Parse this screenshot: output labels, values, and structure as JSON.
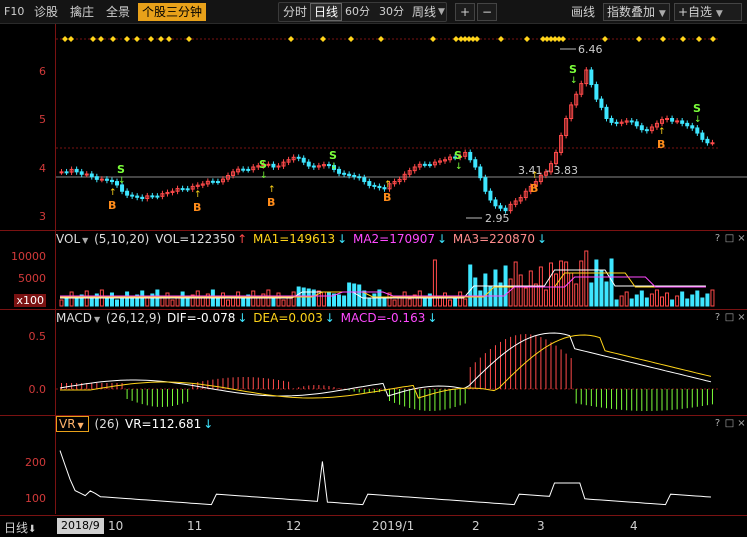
{
  "toolbar": {
    "f10": "F10",
    "diagnose": "诊股",
    "strategy": "擒庄",
    "panorama": "全景",
    "minute_label": "个股三分钟",
    "tf_intraday": "分时",
    "tf_daily": "日线",
    "tf_60": "60分",
    "tf_30": "30分",
    "tf_weekly": "周线",
    "zoom_in": "+",
    "zoom_out": "−",
    "draw": "画线",
    "index_overlay": "指数叠加",
    "add_watch": "+自选"
  },
  "price_panel": {
    "axis_labels": [
      "6",
      "5",
      "4",
      "3"
    ],
    "high_label": "6.46",
    "low_label": "2.95",
    "range_label": "3.41 - 3.83",
    "signal_b": "B",
    "signal_s": "S",
    "colors": {
      "up": "#ff4a4a",
      "down": "#3ee6ff",
      "signal_b": "#ff8c1a",
      "signal_s": "#7bff3a",
      "marker": "#ffd41a"
    }
  },
  "vol_panel": {
    "name": "VOL",
    "params": "(5,10,20)",
    "vol": "VOL=122350",
    "ma1": "MA1=149613",
    "ma2": "MA2=170907",
    "ma3": "MA3=220870",
    "axis_top": "10000",
    "axis_mid": "5000",
    "axis_unit": "x100",
    "colors": {
      "ma1": "#ffffff",
      "ma2": "#ffd41a",
      "ma3": "#ff4aff"
    }
  },
  "macd_panel": {
    "name": "MACD",
    "params": "(26,12,9)",
    "dif": "DIF=-0.078",
    "dea": "DEA=0.003",
    "macd": "MACD=-0.163",
    "axis_top": "0.5",
    "axis_mid": "0.0"
  },
  "vr_panel": {
    "name": "VR",
    "params": "(26)",
    "vr": "VR=112.681",
    "axis_top": "200",
    "axis_mid": "100"
  },
  "panel_buttons": {
    "help": "?",
    "max": "□",
    "close": "×"
  },
  "bottom": {
    "period": "日线",
    "start_date": "2018/9",
    "months": [
      "10",
      "11",
      "12",
      "2019/1",
      "2",
      "3",
      "4"
    ]
  },
  "chart_data": {
    "type": "candlestick",
    "y_range": [
      2.9,
      6.8
    ],
    "high": 6.46,
    "low": 2.95,
    "close_series_approx": [
      3.9,
      3.95,
      3.85,
      3.8,
      3.75,
      3.7,
      3.5,
      3.4,
      3.35,
      3.4,
      3.45,
      3.5,
      3.55,
      3.6,
      3.65,
      3.7,
      3.75,
      3.9,
      3.95,
      4.0,
      4.05,
      4.0,
      4.1,
      4.2,
      4.1,
      4.0,
      4.05,
      3.95,
      3.85,
      3.8,
      3.7,
      3.6,
      3.55,
      3.7,
      3.85,
      4.0,
      4.05,
      4.1,
      4.15,
      4.2,
      4.3,
      4.0,
      3.5,
      3.2,
      3.1,
      3.3,
      3.5,
      3.7,
      3.9,
      4.3,
      5.0,
      5.5,
      6.0,
      5.4,
      5.0,
      4.9,
      4.95,
      4.85,
      4.75,
      4.9,
      5.0,
      4.95,
      4.85,
      4.7,
      4.5
    ]
  }
}
